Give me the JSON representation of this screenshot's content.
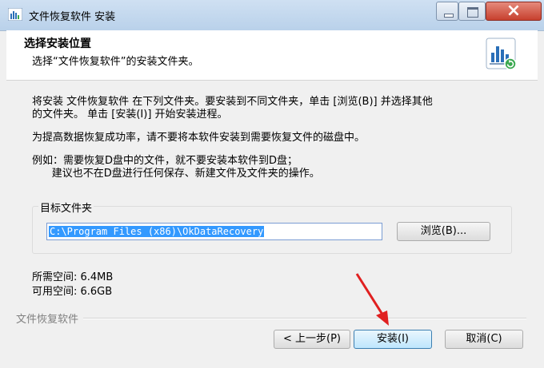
{
  "window": {
    "title": "文件恢复软件 安装"
  },
  "header": {
    "title": "选择安装位置",
    "subtitle": "选择“文件恢复软件”的安装文件夹。"
  },
  "body": {
    "line1": "将安装 文件恢复软件 在下列文件夹。要安装到不同文件夹，单击 [浏览(B)] 并选择其他",
    "line2": "的文件夹。 单击 [安装(I)] 开始安装进程。",
    "line3": "为提高数据恢复成功率，请不要将本软件安装到需要恢复文件的磁盘中。",
    "line4": "例如：需要恢复D盘中的文件，就不要安装本软件到D盘；",
    "line5": "      建议也不在D盘进行任何保存、新建文件及文件夹的操作。"
  },
  "destination": {
    "group_label": "目标文件夹",
    "path_value": "C:\\Program Files (x86)\\OkDataRecovery",
    "browse_label": "浏览(B)..."
  },
  "space": {
    "required": "所需空间: 6.4MB",
    "available": "可用空间: 6.6GB"
  },
  "footer": {
    "brand": "文件恢复软件",
    "back_label": "< 上一步(P)",
    "install_label": "安装(I)",
    "cancel_label": "取消(C)"
  },
  "colors": {
    "selection": "#3399ff",
    "arrow": "#e02020",
    "close_button": "#c7402e"
  }
}
